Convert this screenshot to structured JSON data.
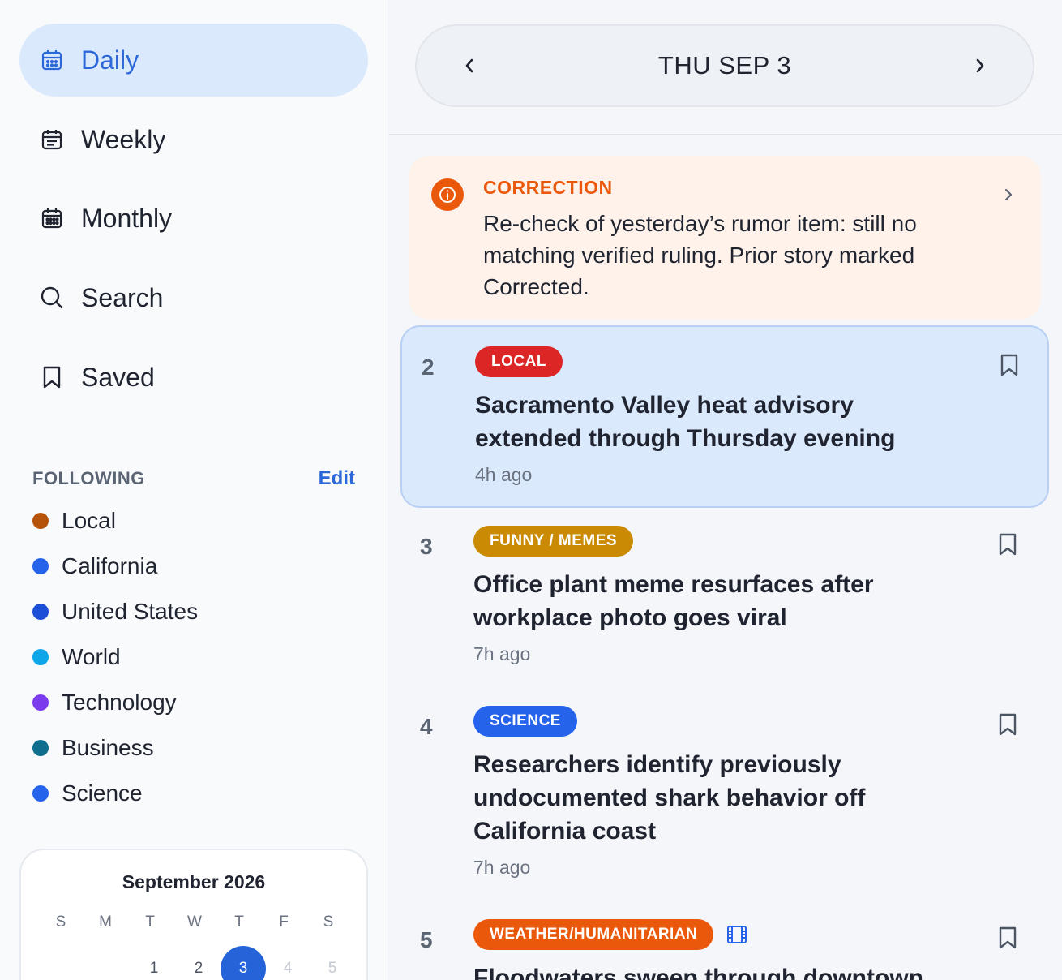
{
  "nav": {
    "items": [
      {
        "label": "Daily",
        "icon": "calendar-icon",
        "active": true
      },
      {
        "label": "Weekly",
        "icon": "calendar-list-icon",
        "active": false
      },
      {
        "label": "Monthly",
        "icon": "calendar-grid-icon",
        "active": false
      },
      {
        "label": "Search",
        "icon": "search-icon",
        "active": false
      },
      {
        "label": "Saved",
        "icon": "bookmark-icon",
        "active": false
      }
    ]
  },
  "following": {
    "title": "FOLLOWING",
    "edit_label": "Edit",
    "items": [
      {
        "label": "Local",
        "color": "#b45309"
      },
      {
        "label": "California",
        "color": "#2563eb"
      },
      {
        "label": "United States",
        "color": "#1d4ed8"
      },
      {
        "label": "World",
        "color": "#0ea5e9"
      },
      {
        "label": "Technology",
        "color": "#7c3aed"
      },
      {
        "label": "Business",
        "color": "#0e6e8c"
      },
      {
        "label": "Science",
        "color": "#2563eb"
      }
    ]
  },
  "calendar": {
    "title": "September 2026",
    "weekdays": [
      "S",
      "M",
      "T",
      "W",
      "T",
      "F",
      "S"
    ],
    "first_row": [
      "",
      "",
      "1",
      "2",
      "3",
      "4",
      "5"
    ],
    "selected_day": "3"
  },
  "header": {
    "date_label": "THU SEP 3"
  },
  "correction": {
    "title": "CORRECTION",
    "text": "Re-check of yesterday’s rumor item: still no matching verified ruling. Prior story marked Corrected."
  },
  "stories": [
    {
      "number": "2",
      "tag": "LOCAL",
      "tag_color": "#dc2626",
      "title": "Sacramento Valley heat advisory extended through Thursday evening",
      "time": "4h ago",
      "highlighted": true
    },
    {
      "number": "3",
      "tag": "FUNNY / MEMES",
      "tag_color": "#ca8a04",
      "title": "Office plant meme resurfaces after workplace photo goes viral",
      "time": "7h ago",
      "highlighted": false
    },
    {
      "number": "4",
      "tag": "SCIENCE",
      "tag_color": "#2563eb",
      "title": "Researchers identify previously undocumented shark behavior off California coast",
      "time": "7h ago",
      "highlighted": false
    },
    {
      "number": "5",
      "tag": "WEATHER/HUMANITARIAN",
      "tag_color": "#ea580c",
      "title": "Floodwaters sweep through downtown",
      "time": "",
      "highlighted": false,
      "has_video": true,
      "video_icon": "film-icon"
    }
  ]
}
